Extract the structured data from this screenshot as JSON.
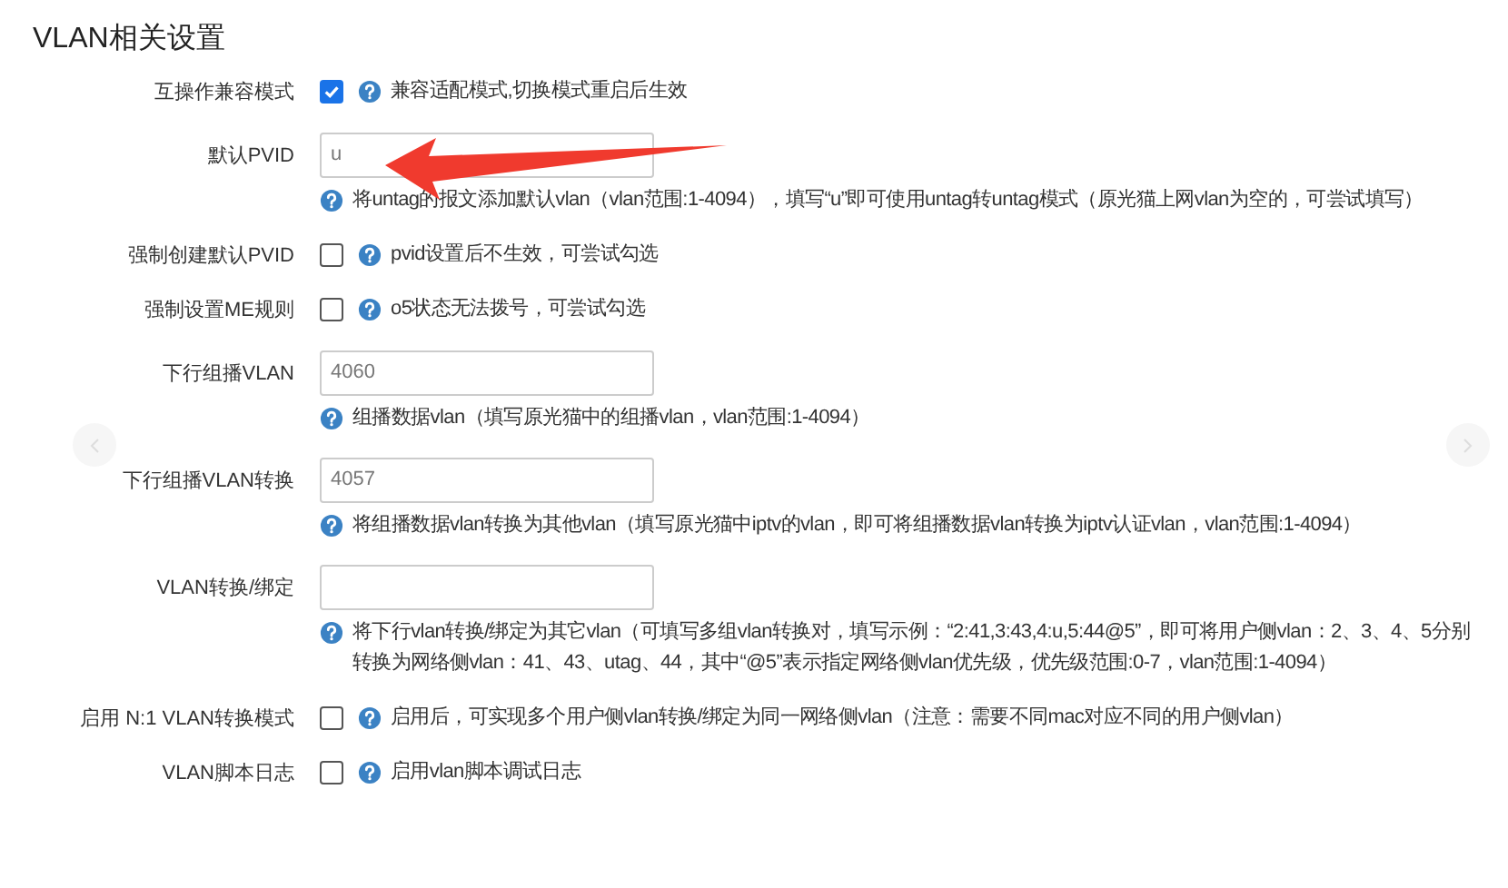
{
  "title": "VLAN相关设置",
  "rows": [
    {
      "kind": "checkbox",
      "label": "互操作兼容模式",
      "checked": true,
      "help": "兼容适配模式,切换模式重启后生效"
    },
    {
      "kind": "input",
      "label": "默认PVID",
      "value": "u",
      "help": "将untag的报文添加默认vlan（vlan范围:1-4094），填写“u”即可使用untag转untag模式（原光猫上网vlan为空的，可尝试填写）"
    },
    {
      "kind": "checkbox",
      "label": "强制创建默认PVID",
      "checked": false,
      "help": "pvid设置后不生效，可尝试勾选"
    },
    {
      "kind": "checkbox",
      "label": "强制设置ME规则",
      "checked": false,
      "help": "o5状态无法拨号，可尝试勾选"
    },
    {
      "kind": "input",
      "label": "下行组播VLAN",
      "placeholder": "4060",
      "help": "组播数据vlan（填写原光猫中的组播vlan，vlan范围:1-4094）"
    },
    {
      "kind": "input",
      "label": "下行组播VLAN转换",
      "placeholder": "4057",
      "help": "将组播数据vlan转换为其他vlan（填写原光猫中iptv的vlan，即可将组播数据vlan转换为iptv认证vlan，vlan范围:1-4094）"
    },
    {
      "kind": "input",
      "label": "VLAN转换/绑定",
      "help": "将下行vlan转换/绑定为其它vlan（可填写多组vlan转换对，填写示例：“2:41,3:43,4:u,5:44@5”，即可将用户侧vlan：2、3、4、5分别转换为网络侧vlan：41、43、utag、44，其中“@5”表示指定网络侧vlan优先级，优先级范围:0-7，vlan范围:1-4094）"
    },
    {
      "kind": "checkbox",
      "label": "启用 N:1 VLAN转换模式",
      "checked": false,
      "help": "启用后，可实现多个用户侧vlan转换/绑定为同一网络侧vlan（注意：需要不同mac对应不同的用户侧vlan）"
    },
    {
      "kind": "checkbox",
      "label": "VLAN脚本日志",
      "checked": false,
      "help": "启用vlan脚本调试日志"
    }
  ]
}
